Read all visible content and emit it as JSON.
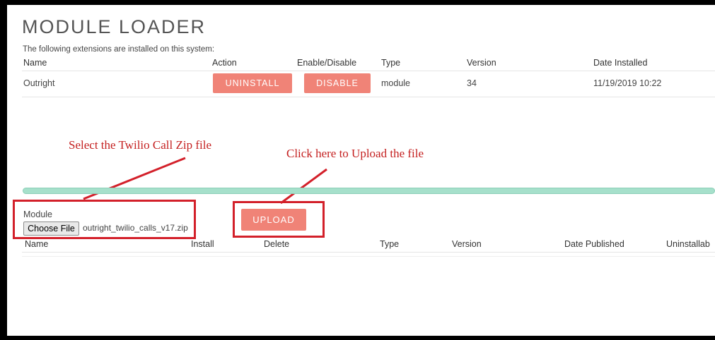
{
  "title": "MODULE LOADER",
  "subtitle": "The following extensions are installed on this system:",
  "installed_table": {
    "headers": [
      "Name",
      "Action",
      "Enable/Disable",
      "Type",
      "Version",
      "Date Installed"
    ],
    "rows": [
      {
        "name": "Outright",
        "action_label": "UNINSTALL",
        "enable_label": "DISABLE",
        "type": "module",
        "version": "34",
        "date_installed": "11/19/2019 10:22"
      }
    ]
  },
  "annotations": {
    "select_zip": "Select the Twilio Call Zip file",
    "upload_hint": "Click here to Upload the file"
  },
  "upload_form": {
    "module_label": "Module",
    "choose_file_label": "Choose File",
    "file_name": "outright_twilio_calls_v17.zip",
    "upload_label": "UPLOAD"
  },
  "available_table": {
    "headers": [
      "Name",
      "Install",
      "Delete",
      "Type",
      "Version",
      "Date Published",
      "Uninstallab"
    ]
  },
  "colors": {
    "button": "#f08377",
    "annotation": "#c41f1f",
    "progress": "#a6e0cb"
  }
}
